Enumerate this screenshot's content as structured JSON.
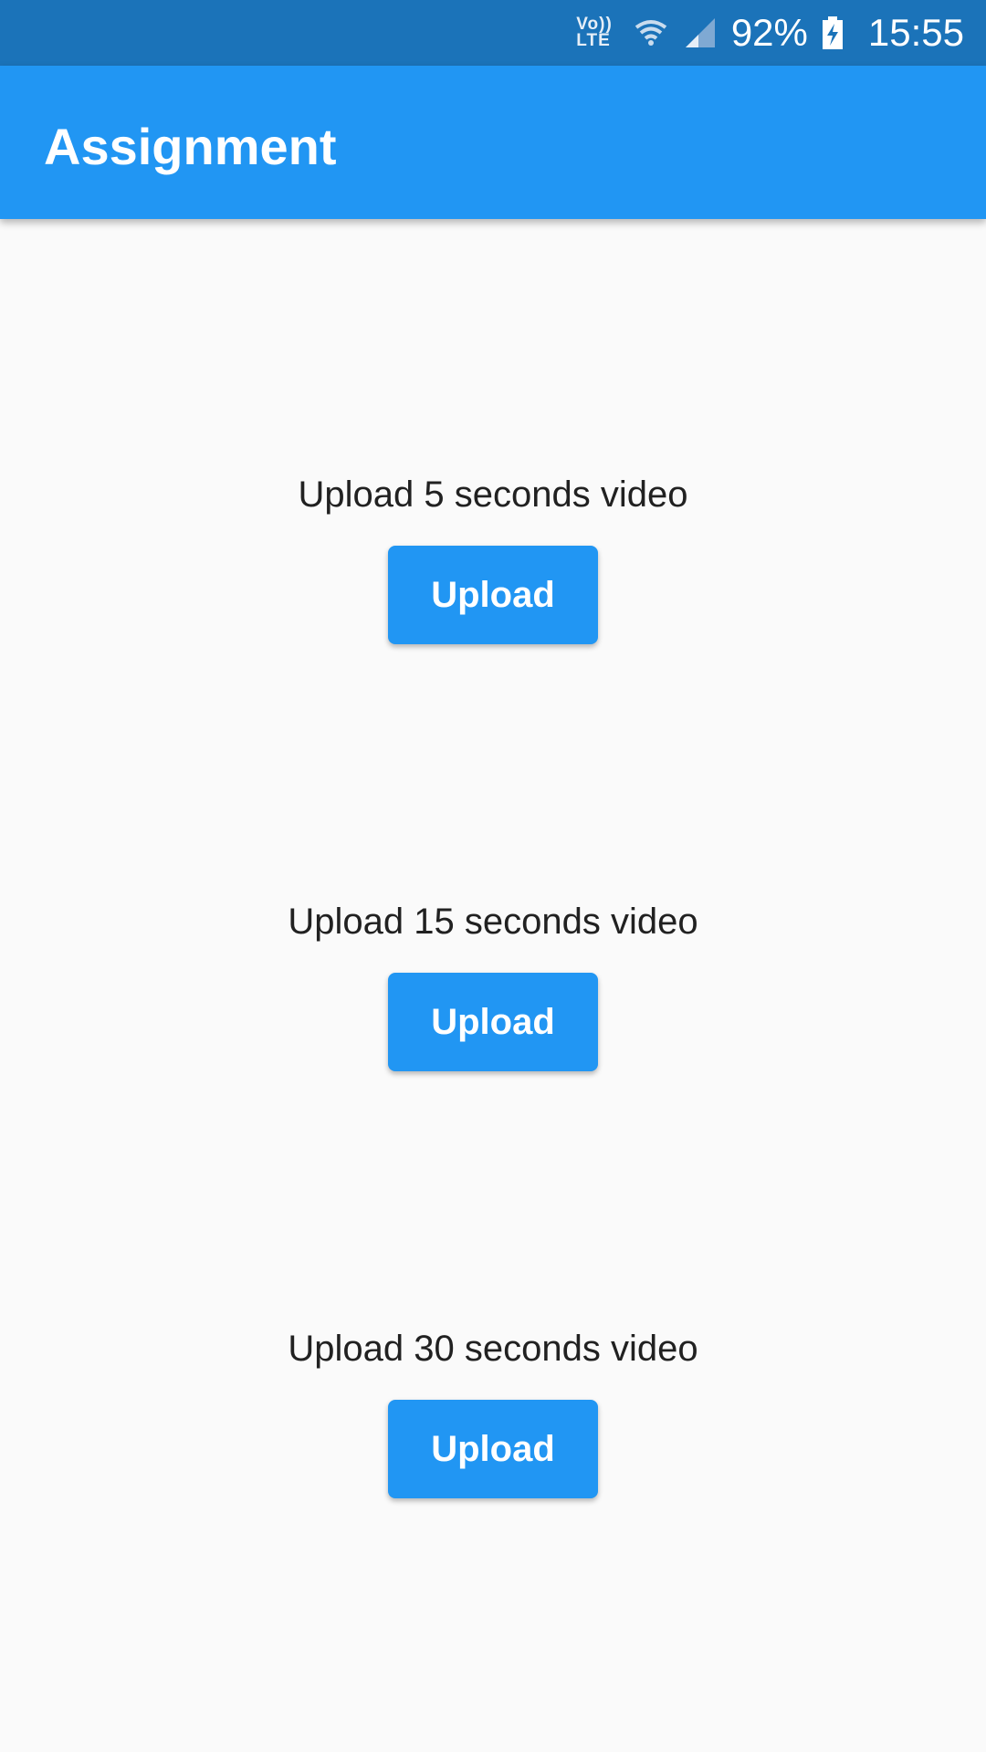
{
  "status_bar": {
    "network_top": "Vo))",
    "network_bottom": "LTE",
    "wifi_icon": "wifi-icon",
    "signal_icon": "signal-icon",
    "battery_percent": "92%",
    "battery_icon": "battery-charging-icon",
    "time": "15:55"
  },
  "app_bar": {
    "title": "Assignment",
    "color": "#2196f3"
  },
  "sections": [
    {
      "label": "Upload 5 seconds video",
      "button_label": "Upload"
    },
    {
      "label": "Upload 15 seconds video",
      "button_label": "Upload"
    },
    {
      "label": "Upload 30 seconds video",
      "button_label": "Upload"
    }
  ],
  "colors": {
    "status_bar": "#1b73b9",
    "accent": "#2196f3",
    "background": "#fafafa",
    "text": "#212121"
  }
}
